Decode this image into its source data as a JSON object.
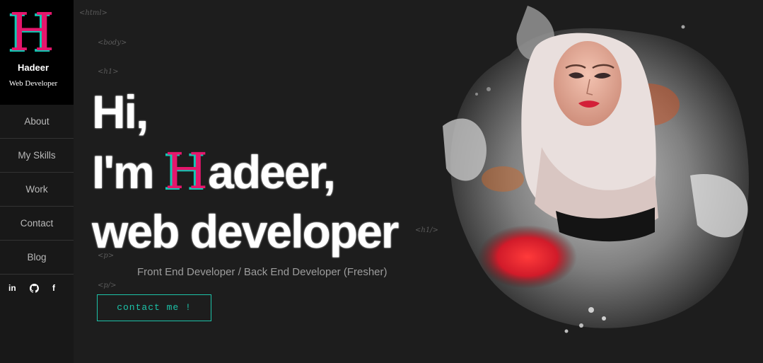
{
  "brand": {
    "letter": "H",
    "name": "Hadeer",
    "subtitle": "Web Developer",
    "pink": "#e5166c",
    "teal": "#11c8b4"
  },
  "nav": {
    "items": [
      {
        "label": "About"
      },
      {
        "label": "My Skills"
      },
      {
        "label": "Work"
      },
      {
        "label": "Contact"
      },
      {
        "label": "Blog"
      }
    ]
  },
  "social": {
    "linkedin": "in",
    "github_icon": "github-icon",
    "facebook": "f"
  },
  "tags": {
    "html_open": "<html>",
    "body_open": "<body>",
    "h1_open": "<h1>",
    "h1_close": "<h1/>",
    "p_open": "<p>",
    "p_close": "<p/>"
  },
  "hero": {
    "line1": "Hi,",
    "line2_prefix": "I'm ",
    "line2_letter": "H",
    "line2_suffix": "adeer,",
    "line3": "web developer"
  },
  "subtitle": "Front End Developer / Back End Developer (Fresher)",
  "cta": {
    "label": "contact me !",
    "color": "#1dc3a9"
  }
}
